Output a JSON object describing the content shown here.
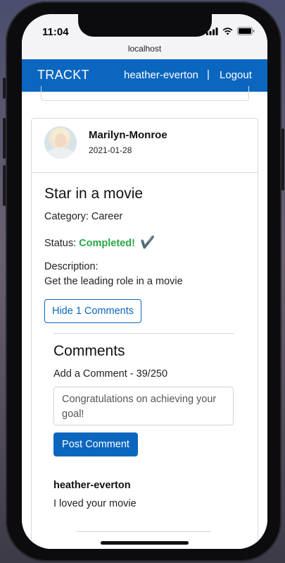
{
  "status_bar": {
    "time": "11:04"
  },
  "browser": {
    "url": "localhost"
  },
  "navbar": {
    "brand": "TRACKT",
    "user": "heather-everton",
    "separator": "|",
    "logout": "Logout"
  },
  "post": {
    "author": "Marilyn-Monroe",
    "date": "2021-01-28",
    "title": "Star in a movie",
    "category_line": "Category: Career",
    "status_label": "Status:",
    "status_value": "Completed!",
    "status_icon": "✔️",
    "description_label": "Description:",
    "description_text": "Get the leading role in a movie",
    "toggle_comments_label": "Hide 1 Comments"
  },
  "comments": {
    "heading": "Comments",
    "add_label": "Add a Comment - 39/250",
    "input_value": "Congratulations on achieving your goal!",
    "post_button": "Post Comment",
    "items": [
      {
        "author": "heather-everton",
        "text": "I loved your movie"
      }
    ]
  },
  "colors": {
    "primary": "#0b66bf",
    "success": "#28a745"
  },
  "icons": {
    "signal": "signal-icon",
    "wifi": "wifi-icon",
    "battery": "battery-icon",
    "check": "check-icon"
  }
}
